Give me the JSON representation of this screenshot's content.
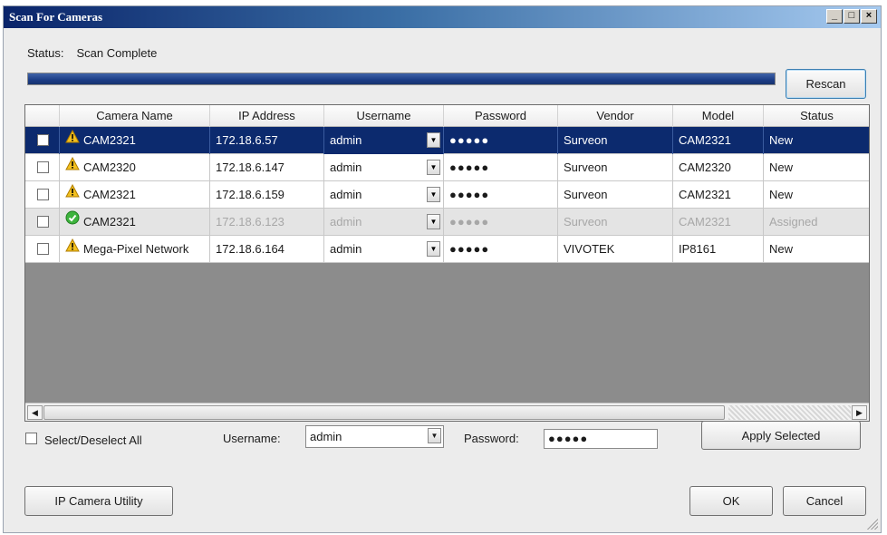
{
  "window": {
    "title": "Scan For Cameras",
    "min": "_",
    "max": "□",
    "close": "×"
  },
  "status": {
    "label": "Status:",
    "value": "Scan Complete",
    "progress_percent": 100
  },
  "buttons": {
    "rescan": "Rescan",
    "apply_selected": "Apply Selected",
    "ip_camera_utility": "IP Camera Utility",
    "ok": "OK",
    "cancel": "Cancel"
  },
  "table": {
    "columns": [
      "Camera Name",
      "IP Address",
      "Username",
      "Password",
      "Vendor",
      "Model",
      "Status"
    ],
    "rows": [
      {
        "checked": false,
        "selected": true,
        "dim": false,
        "icon": "warning-icon",
        "name": "CAM2321",
        "ip": "172.18.6.57",
        "username": "admin",
        "password": "●●●●●",
        "vendor": "Surveon",
        "model": "CAM2321",
        "status": "New"
      },
      {
        "checked": false,
        "selected": false,
        "dim": false,
        "icon": "warning-icon",
        "name": "CAM2320",
        "ip": "172.18.6.147",
        "username": "admin",
        "password": "●●●●●",
        "vendor": "Surveon",
        "model": "CAM2320",
        "status": "New"
      },
      {
        "checked": false,
        "selected": false,
        "dim": false,
        "icon": "warning-icon",
        "name": "CAM2321",
        "ip": "172.18.6.159",
        "username": "admin",
        "password": "●●●●●",
        "vendor": "Surveon",
        "model": "CAM2321",
        "status": "New"
      },
      {
        "checked": false,
        "selected": false,
        "dim": true,
        "icon": "check-circle-icon",
        "name": "CAM2321",
        "ip": "172.18.6.123",
        "username": "admin",
        "password": "●●●●●",
        "vendor": "Surveon",
        "model": "CAM2321",
        "status": "Assigned"
      },
      {
        "checked": false,
        "selected": false,
        "dim": false,
        "icon": "warning-icon",
        "name": "Mega-Pixel Network",
        "ip": "172.18.6.164",
        "username": "admin",
        "password": "●●●●●",
        "vendor": "VIVOTEK",
        "model": "IP8161",
        "status": "New"
      }
    ]
  },
  "bottom": {
    "select_all_label": "Select/Deselect All",
    "username_label": "Username:",
    "username_value": "admin",
    "password_label": "Password:",
    "password_value": "●●●●●"
  },
  "colors": {
    "selection": "#0c2a6e",
    "progress": "#1c3d86",
    "warning": "#f2c01e",
    "ok": "#3db33d"
  }
}
